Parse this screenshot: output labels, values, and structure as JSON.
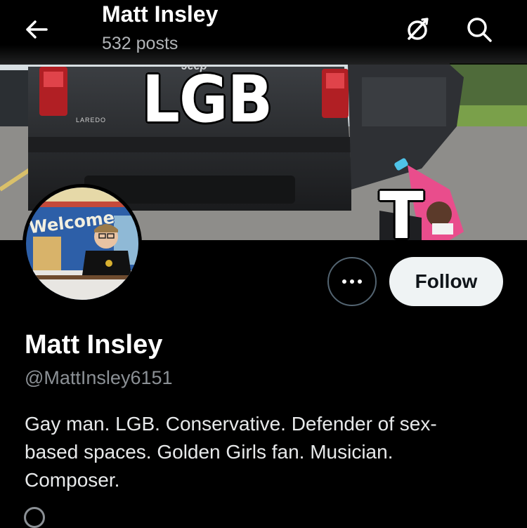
{
  "header": {
    "title": "Matt Insley",
    "posts_count": "532 posts",
    "back_icon": "arrow-left-icon",
    "grok_icon": "grok-icon",
    "search_icon": "search-icon"
  },
  "banner": {
    "vehicle_brand": "Jeep",
    "vehicle_model": "LAREDO",
    "meme_text_main": "LGB",
    "meme_text_secondary": "T"
  },
  "avatar": {
    "sign_text": "Welcome"
  },
  "actions": {
    "more_icon": "more-horizontal-icon",
    "follow_label": "Follow"
  },
  "profile": {
    "name": "Matt Insley",
    "handle": "@MattInsley6151",
    "bio": "Gay man. LGB. Conservative. Defender of sex-based spaces. Golden Girls fan. Musician. Composer."
  },
  "colors": {
    "background": "#000000",
    "text_primary": "#e7e9ea",
    "text_secondary": "#8b9095",
    "follow_bg": "#eff3f4",
    "follow_text": "#0f1419",
    "border": "#536471"
  }
}
